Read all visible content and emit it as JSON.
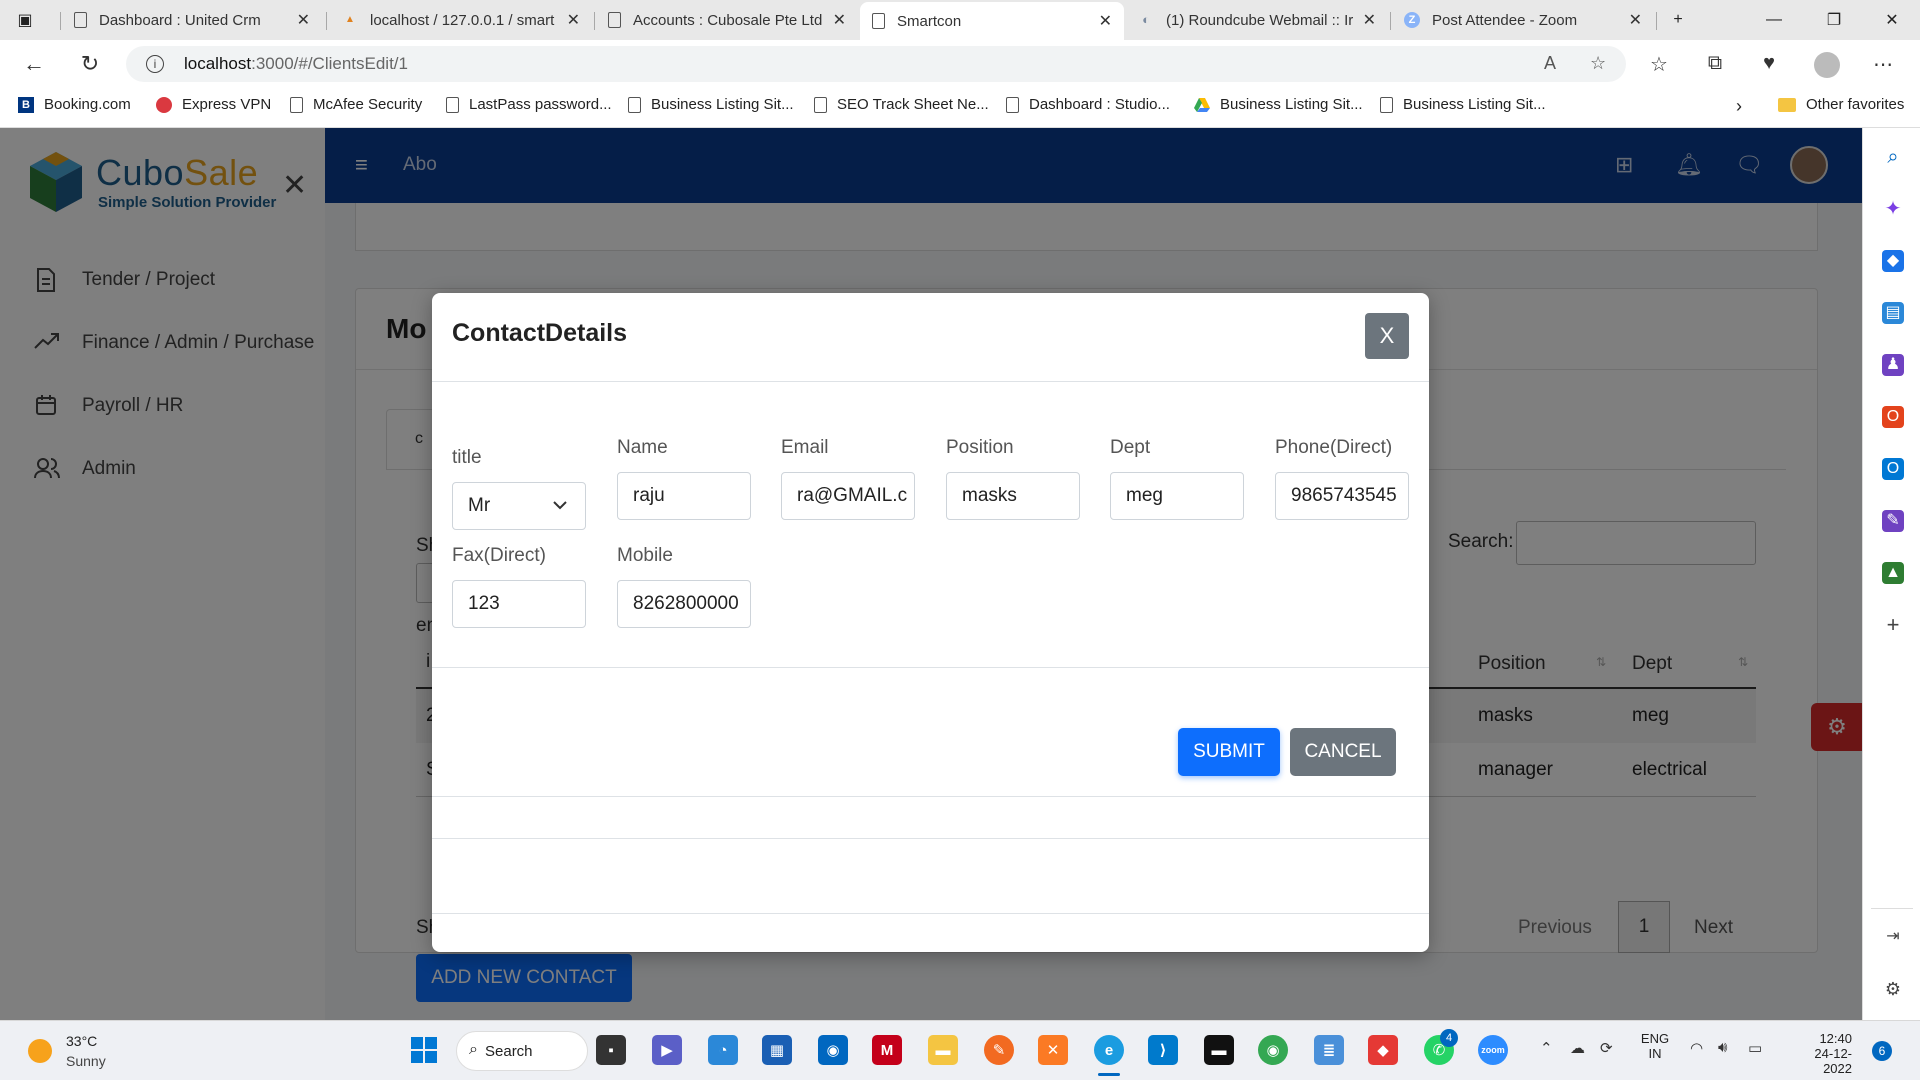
{
  "browser": {
    "tabs": [
      {
        "title": "Dashboard : United Crm"
      },
      {
        "title": "localhost / 127.0.0.1 / smart"
      },
      {
        "title": "Accounts : Cubosale Pte Ltd"
      },
      {
        "title": "Smartcon"
      },
      {
        "title": "(1) Roundcube Webmail :: Ir"
      },
      {
        "title": "Post Attendee - Zoom"
      }
    ],
    "url_host": "localhost",
    "url_path": ":3000/#/ClientsEdit/1",
    "bookmarks": [
      "Booking.com",
      "Express VPN",
      "McAfee Security",
      "LastPass password...",
      "Business Listing Sit...",
      "SEO Track Sheet Ne...",
      "Dashboard : Studio...",
      "Business Listing Sit...",
      "Business Listing Sit..."
    ],
    "other_favorites": "Other favorites"
  },
  "app": {
    "logo_name_a": "Cubo",
    "logo_name_b": "Sale",
    "logo_tagline": "Simple Solution Provider",
    "nav": [
      {
        "label": "Tender / Project",
        "icon": "document-icon"
      },
      {
        "label": "Finance / Admin / Purchase",
        "icon": "trend-up-icon"
      },
      {
        "label": "Payroll / HR",
        "icon": "calendar-icon"
      },
      {
        "label": "Admin",
        "icon": "users-icon"
      }
    ],
    "topbar_title": "Abo",
    "page_title_fragment": "Mo",
    "tab_fragment": "c",
    "search_label": "Search:",
    "left_fragments": [
      "Sh",
      "en",
      "i",
      "2",
      "S",
      "Sh"
    ],
    "table": {
      "headers": [
        "Position",
        "Dept"
      ],
      "rows": [
        {
          "position": "masks",
          "dept": "meg"
        },
        {
          "position": "manager",
          "dept": "electrical"
        }
      ]
    },
    "pager": {
      "previous": "Previous",
      "page": "1",
      "next": "Next"
    },
    "add_contact_label": "ADD NEW CONTACT"
  },
  "modal": {
    "title": "ContactDetails",
    "close_label": "X",
    "fields": {
      "title": {
        "label": "title",
        "value": "Mr"
      },
      "name": {
        "label": "Name",
        "value": "raju"
      },
      "email": {
        "label": "Email",
        "value": "ra@GMAIL.c"
      },
      "position": {
        "label": "Position",
        "value": "masks"
      },
      "dept": {
        "label": "Dept",
        "value": "meg"
      },
      "phone": {
        "label": "Phone(Direct)",
        "value": "9865743545"
      },
      "fax": {
        "label": "Fax(Direct)",
        "value": "123"
      },
      "mobile": {
        "label": "Mobile",
        "value": "8262800000"
      }
    },
    "submit_label": "SUBMIT",
    "cancel_label": "CANCEL"
  },
  "taskbar": {
    "temperature": "33°C",
    "condition": "Sunny",
    "search_label": "Search",
    "lang_line1": "ENG",
    "lang_line2": "IN",
    "time": "12:40",
    "date": "24-12-2022",
    "notification_count": "6",
    "whatsapp_badge": "4"
  },
  "colors": {
    "topbar": "#0a3d91",
    "primary": "#0d6efd",
    "secondary": "#6c757d",
    "danger": "#d62b2b"
  }
}
